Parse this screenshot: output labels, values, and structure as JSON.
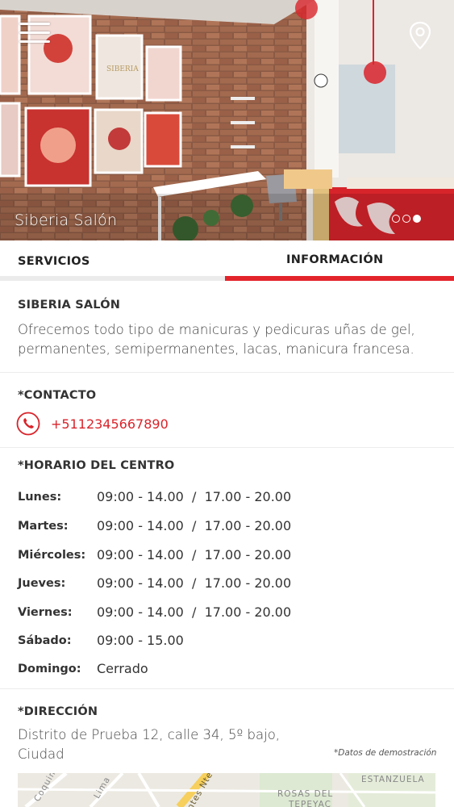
{
  "hero": {
    "title": "Siberia Salón",
    "sign_text": "SIBERIA",
    "menu_icon": "hamburger-menu-icon",
    "location_icon": "map-pin-icon",
    "slides_total": 3,
    "slide_active": 3
  },
  "tabs": [
    {
      "label": "SERVICIOS",
      "active": false
    },
    {
      "label": "INFORMACIÓN",
      "active": true
    }
  ],
  "colors": {
    "accent": "#e3242b",
    "link": "#d9232a",
    "tab_inactive_line": "#ebebeb"
  },
  "about": {
    "title": "SIBERIA SALÓN",
    "line1": "Ofrecemos todo tipo de manicuras y pedicuras uñas de gel,",
    "line2": "permanentes, semipermanentes, lacas, manicura francesa."
  },
  "contact": {
    "title": "*CONTACTO",
    "phone_icon": "phone-icon",
    "phone": "+5112345667890"
  },
  "hours": {
    "title": "*HORARIO DEL CENTRO",
    "rows": [
      {
        "day": "Lunes:",
        "value": "09:00 - 14.00  /  17.00 - 20.00"
      },
      {
        "day": "Martes:",
        "value": "09:00 - 14.00  /  17.00 - 20.00"
      },
      {
        "day": "Miércoles:",
        "value": "09:00 - 14.00  /  17.00 - 20.00"
      },
      {
        "day": "Jueves:",
        "value": "09:00 - 14.00  /  17.00 - 20.00"
      },
      {
        "day": "Viernes:",
        "value": "09:00 - 14.00  /  17.00 - 20.00"
      },
      {
        "day": "Sábado:",
        "value": "09:00 - 15.00"
      },
      {
        "day": "Domingo:",
        "value": "Cerrado"
      }
    ]
  },
  "address": {
    "title": "*DIRECCIÓN",
    "line1": "Distrito de Prueba 12, calle 34, 5º bajo,",
    "line2": "Ciudad",
    "demo_note": "*Datos de demostración"
  },
  "map": {
    "labels": [
      "Coquimbo",
      "Lima",
      "ntes Nte",
      "ROSAS DEL",
      "TEPEYAC",
      "ESTANZUELA"
    ]
  }
}
